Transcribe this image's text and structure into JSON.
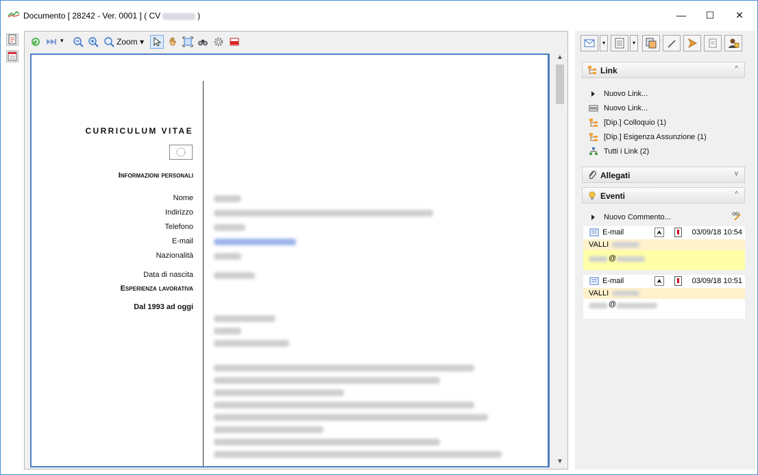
{
  "window": {
    "title_prefix": "Documento [ 28242 - Ver. 0001 ] ( CV",
    "title_suffix": ")",
    "minimize": "—",
    "maximize": "☐",
    "close": "✕"
  },
  "viewer_toolbar": {
    "zoom_label": "Zoom",
    "zoom_arrow": "▾",
    "next_arrow": "▾"
  },
  "cv": {
    "title": "CURRICULUM VITAE",
    "section_personal": "Informazioni personali",
    "labels": [
      "Nome",
      "Indirizzo",
      "Telefono",
      "E-mail",
      "Nazionalità",
      "Data di nascita"
    ],
    "section_experience": "Esperienza lavorativa",
    "period": "Dal 1993  ad oggi"
  },
  "right_panel": {
    "link_section": {
      "title": "Link",
      "chevron": "^"
    },
    "links": [
      {
        "label": "Nuovo Link...",
        "icon": "play-icon"
      },
      {
        "label": "Nuovo Link...",
        "icon": "barcode-icon"
      },
      {
        "label": "[Dip.] Colloquio (1)",
        "icon": "tree-icon"
      },
      {
        "label": "[Dip.] Esigenza Assunzione (1)",
        "icon": "tree-icon"
      },
      {
        "label": "Tutti i Link (2)",
        "icon": "network-icon"
      }
    ],
    "attachments_section": {
      "title": "Allegati",
      "chevron": "v"
    },
    "events_section": {
      "title": "Eventi",
      "chevron": "^"
    },
    "new_comment": "Nuovo Commento...",
    "events": [
      {
        "type": "E-mail",
        "date": "03/09/18 10:54",
        "name": "VALLI",
        "at": "@",
        "up": "⮝"
      },
      {
        "type": "E-mail",
        "date": "03/09/18 10:51",
        "name": "VALLI",
        "at": "@",
        "up": "⮝"
      }
    ]
  },
  "colors": {
    "window_border": "#4a90d9",
    "doc_border": "#4c7fc4",
    "event_highlight": "#ffffa8",
    "event_name_bg": "#fff2cc"
  }
}
